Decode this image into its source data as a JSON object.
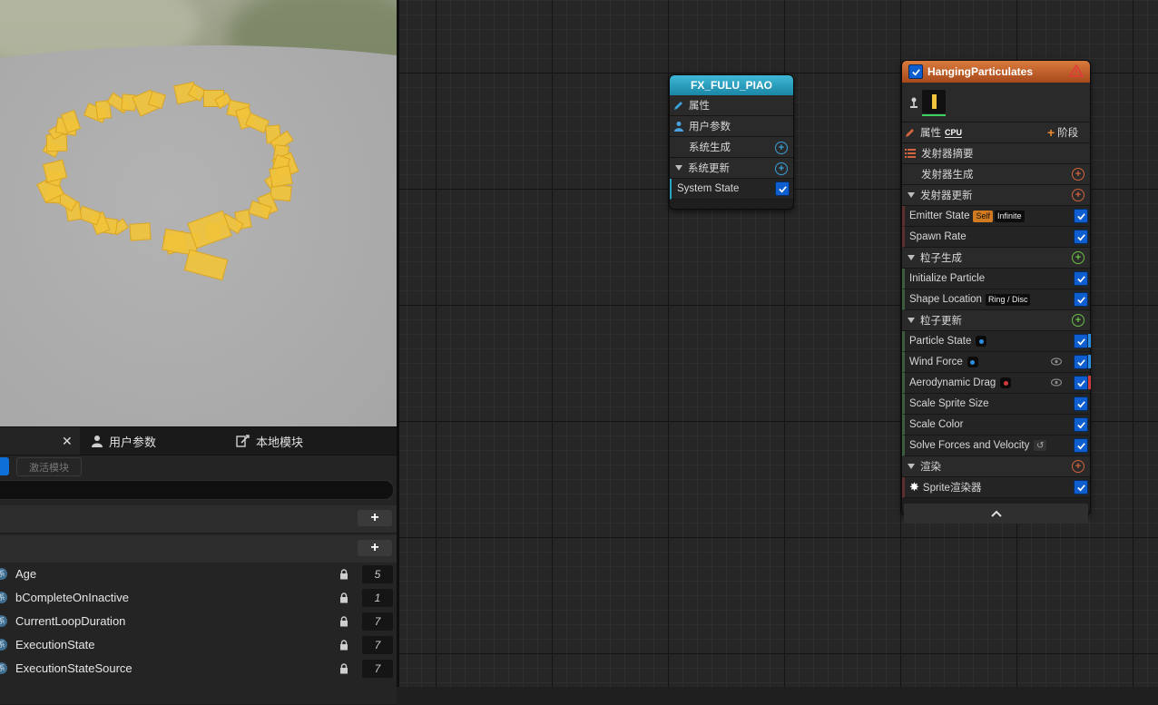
{
  "colors": {
    "accent_blue": "#0e6fd8",
    "system_header": "#2aa3c2",
    "emitter_header": "#c9622a",
    "emitter_marker": "#5c2f2f",
    "particle_marker": "#3d5b3d",
    "add_orange": "#d2643f",
    "add_green": "#6cbf4b",
    "add_blue": "#3aa0d8",
    "warning_red": "#e23a3a"
  },
  "params_panel": {
    "tabs": [
      {
        "label": "用户参数",
        "icon": "user-icon"
      },
      {
        "label": "本地模块",
        "icon": "local-module-icon"
      }
    ],
    "activate_button": "激活模块",
    "params": [
      {
        "name": "Age",
        "value": "5",
        "icon_text": "系"
      },
      {
        "name": "bCompleteOnInactive",
        "value": "1",
        "icon_text": "系"
      },
      {
        "name": "CurrentLoopDuration",
        "value": "7",
        "icon_text": "系"
      },
      {
        "name": "ExecutionState",
        "value": "7",
        "icon_text": "系"
      },
      {
        "name": "ExecutionStateSource",
        "value": "7",
        "icon_text": "系"
      }
    ]
  },
  "system_node": {
    "title": "FX_FULU_PIAO",
    "rows": {
      "properties": "属性",
      "user_params": "用户参数",
      "system_spawn": "系统生成",
      "system_update": "系统更新",
      "system_state": "System State"
    }
  },
  "emitter_node": {
    "title": "HangingParticulates",
    "properties": "属性",
    "sim_target": "CPU",
    "stage_button": "阶段",
    "emitter_summary": "发射器摘要",
    "emitter_spawn": "发射器生成",
    "emitter_update": "发射器更新",
    "emitter_state": {
      "label": "Emitter State",
      "chip1": "Self",
      "chip2": "Infinite"
    },
    "spawn_rate": "Spawn Rate",
    "particle_spawn": "粒子生成",
    "initialize_particle": "Initialize Particle",
    "shape_location": {
      "label": "Shape Location",
      "chip": "Ring / Disc"
    },
    "particle_update": "粒子更新",
    "particle_state": "Particle State",
    "wind_force": "Wind Force",
    "aerodynamic_drag": "Aerodynamic Drag",
    "scale_sprite_size": "Scale Sprite Size",
    "scale_color": "Scale Color",
    "solve_forces": "Solve Forces and Velocity",
    "render": "渲染",
    "sprite_renderer": "Sprite渲染器"
  }
}
